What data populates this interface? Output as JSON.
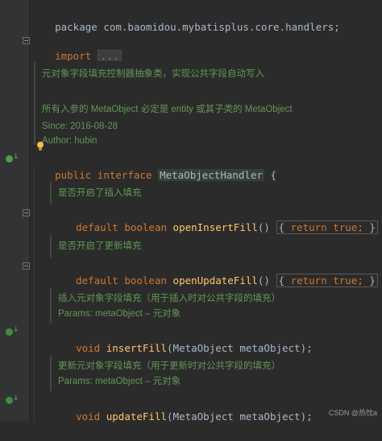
{
  "code": {
    "package_line": "package com.baomidou.mybatisplus.core.handlers;",
    "import_kw": "import",
    "import_fold": "...",
    "doc1": {
      "desc": "元对象字段填充控制器抽象类，实现公共字段自动写入",
      "note": "所有入参的 MetaObject 必定是 entity 或其子类的 MetaObject",
      "since": "Since:   2016-08-28",
      "author": "Author: hubin"
    },
    "iface": {
      "mod1": "public",
      "mod2": "interface",
      "name": "MetaObjectHandler",
      "open": " {"
    },
    "m1": {
      "doc": "是否开启了插入填充",
      "default": "default",
      "type": "boolean",
      "name": "openInsertFill",
      "parens": "()",
      "ret": "return",
      "val": "true;",
      "lb": "{",
      "rb": "}"
    },
    "m2": {
      "doc": "是否开启了更新填充",
      "default": "default",
      "type": "boolean",
      "name": "openUpdateFill",
      "parens": "()",
      "ret": "return",
      "val": "true;",
      "lb": "{",
      "rb": "}"
    },
    "m3": {
      "doc": "插入元对象字段填充（用于插入时对公共字段的填充）",
      "params": "Params: metaObject – 元对象",
      "void": "void",
      "name": "insertFill",
      "args": "(MetaObject metaObject);"
    },
    "m4": {
      "doc": "更新元对象字段填充（用于更新时对公共字段的填充）",
      "params": "Params: metaObject – 元对象",
      "void": "void",
      "name": "updateFill",
      "args": "(MetaObject metaObject);"
    }
  },
  "watermark": "CSDN @热忱a",
  "colors": {
    "background": "#2b2b2b",
    "keyword": "#cc7832",
    "method": "#ffc66d",
    "text": "#a9b7c6",
    "doc": "#629755"
  },
  "icons": [
    "implemented-icon",
    "fold-icon",
    "intention-bulb-icon"
  ]
}
